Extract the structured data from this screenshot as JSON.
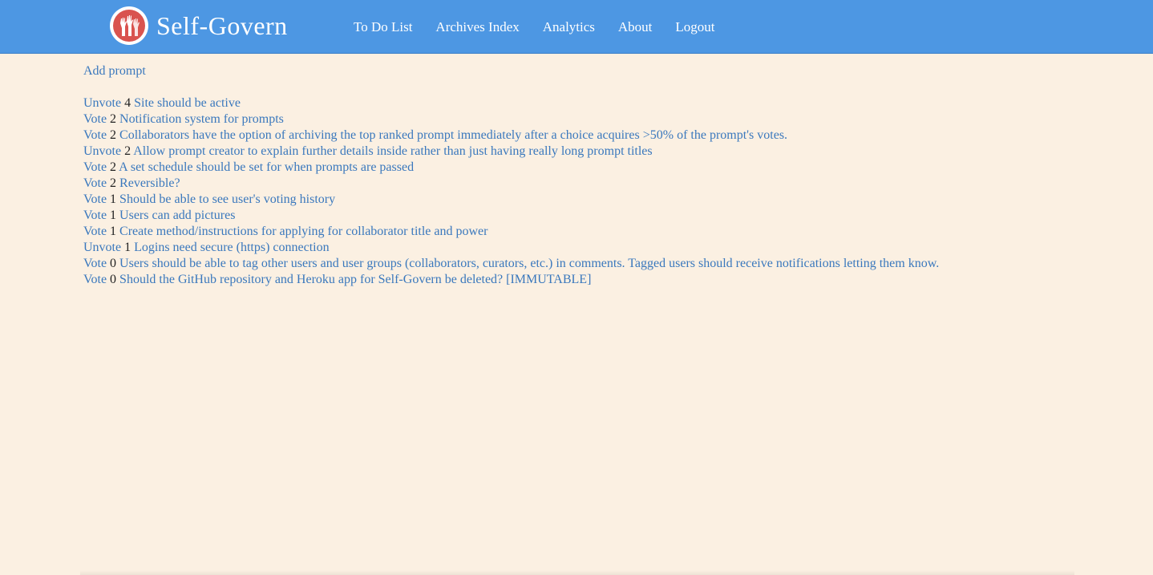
{
  "header": {
    "brand": "Self-Govern",
    "nav": [
      {
        "label": "To Do List"
      },
      {
        "label": "Archives Index"
      },
      {
        "label": "Analytics"
      },
      {
        "label": "About"
      },
      {
        "label": "Logout"
      }
    ]
  },
  "colors": {
    "navbar": "#4d97e3",
    "background": "#fbf0e2",
    "link": "#3a78bd",
    "logo_red": "#d9534f"
  },
  "icons": {
    "logo": "raised-hands-icon"
  },
  "main": {
    "add_prompt": "Add prompt",
    "prompts": [
      {
        "action": "Unvote",
        "votes": "4",
        "title": "Site should be active"
      },
      {
        "action": "Vote",
        "votes": "2",
        "title": "Notification system for prompts"
      },
      {
        "action": "Vote",
        "votes": "2",
        "title": "Collaborators have the option of archiving the top ranked prompt immediately after a choice acquires >50% of the prompt's votes."
      },
      {
        "action": "Unvote",
        "votes": "2",
        "title": "Allow prompt creator to explain further details inside rather than just having really long prompt titles"
      },
      {
        "action": "Vote",
        "votes": "2",
        "title": "A set schedule should be set for when prompts are passed"
      },
      {
        "action": "Vote",
        "votes": "2",
        "title": "Reversible?"
      },
      {
        "action": "Vote",
        "votes": "1",
        "title": "Should be able to see user's voting history"
      },
      {
        "action": "Vote",
        "votes": "1",
        "title": "Users can add pictures"
      },
      {
        "action": "Vote",
        "votes": "1",
        "title": "Create method/instructions for applying for collaborator title and power"
      },
      {
        "action": "Unvote",
        "votes": "1",
        "title": "Logins need secure (https) connection"
      },
      {
        "action": "Vote",
        "votes": "0",
        "title": "Users should be able to tag other users and user groups (collaborators, curators, etc.) in comments. Tagged users should receive notifications letting them know."
      },
      {
        "action": "Vote",
        "votes": "0",
        "title": "Should the GitHub repository and Heroku app for Self-Govern be deleted? [IMMUTABLE]"
      }
    ]
  }
}
